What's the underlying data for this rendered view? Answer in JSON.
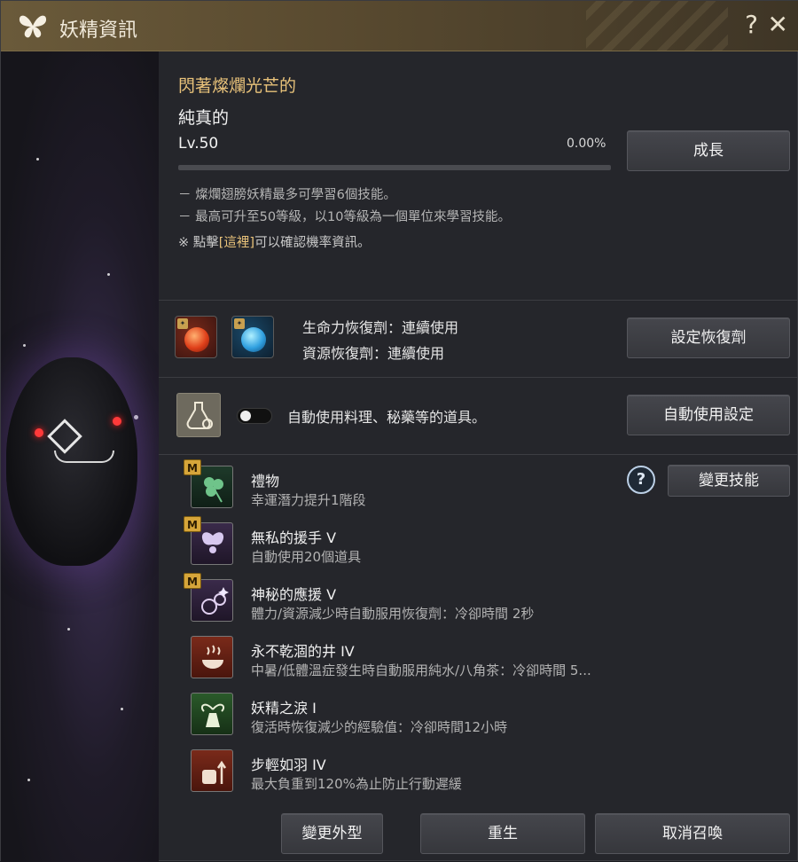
{
  "window": {
    "title": "妖精資訊",
    "help_label": "?",
    "close_label": "✕"
  },
  "fairy": {
    "name_line1": "閃著燦爛光芒的",
    "name_line2": "純真的",
    "level": "Lv.50",
    "exp_percent_text": "0.00%",
    "exp_fraction": 0.0,
    "grow_button": "成長"
  },
  "info": {
    "line1": "－ 燦爛翅膀妖精最多可學習6個技能。",
    "line2": "－ 最高可升至50等級，以10等級為一個單位來學習技能。",
    "line3_prefix": "※ 點擊",
    "line3_link": "[這裡]",
    "line3_suffix": "可以確認機率資訊。"
  },
  "potions": {
    "hp_text": "生命力恢復劑：連續使用",
    "resource_text": "資源恢復劑：連續使用",
    "set_button": "設定恢復劑"
  },
  "auto_use": {
    "label": "自動使用料理、秘藥等的道具。",
    "toggle_on": false,
    "settings_button": "自動使用設定"
  },
  "skills_header": {
    "help_label": "?",
    "change_button": "變更技能"
  },
  "skills": [
    {
      "name": "禮物",
      "desc": "幸運潛力提升1階段",
      "badge": "M",
      "icon": "clover-icon"
    },
    {
      "name": "無私的援手 V",
      "desc": "自動使用20個道具",
      "badge": "M",
      "icon": "fairy-wings-icon"
    },
    {
      "name": "神秘的應援 V",
      "desc": "體力/資源減少時自動服用恢復劑：冷卻時間 2秒",
      "badge": "M",
      "icon": "potion-sparkle-icon"
    },
    {
      "name": "永不乾涸的井 IV",
      "desc": "中暑/低體溫症發生時自動服用純水/八角茶：冷卻時間 5...",
      "badge": "",
      "icon": "bowl-steam-icon"
    },
    {
      "name": "妖精之淚 I",
      "desc": "復活時恢復減少的經驗值：冷卻時間12小時",
      "badge": "",
      "icon": "angel-vase-icon"
    },
    {
      "name": "步輕如羽 IV",
      "desc": "最大負重到120%為止防止行動遲緩",
      "badge": "",
      "icon": "weight-arrow-icon"
    }
  ],
  "footer": {
    "change_appearance": "變更外型",
    "rebirth": "重生",
    "cancel_summon": "取消召喚"
  }
}
